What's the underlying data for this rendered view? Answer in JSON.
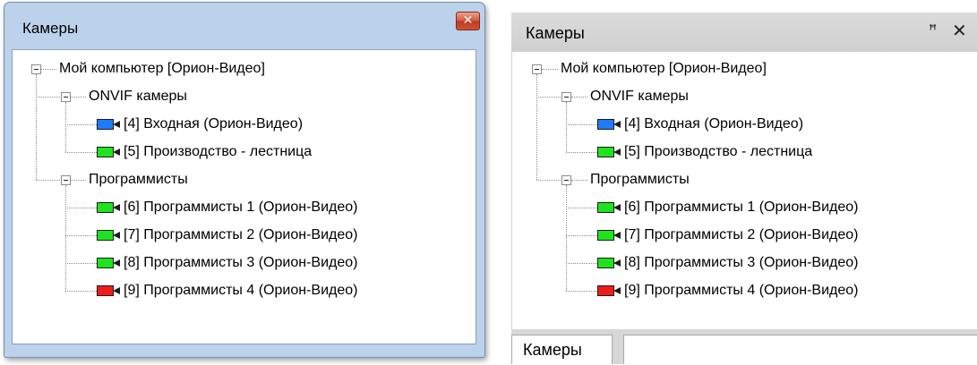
{
  "floating_window": {
    "title": "Камеры",
    "close_glyph": "✕"
  },
  "docked_panel": {
    "title": "Камеры",
    "pin_glyph": "ꟸ",
    "close_glyph": "✕",
    "bottom_tab_label": "Камеры"
  },
  "tree": {
    "root": {
      "label": "Мой компьютер [Орион-Видео]",
      "expanded": true
    },
    "groups": [
      {
        "label": "ONVIF камеры",
        "expanded": true,
        "cameras": [
          {
            "label": "[4] Входная (Орион-Видео)",
            "status_color": "#1f7bff"
          },
          {
            "label": "[5] Производство - лестница",
            "status_color": "#1fe31f"
          }
        ]
      },
      {
        "label": "Программисты",
        "expanded": true,
        "cameras": [
          {
            "label": "[6] Программисты 1 (Орион-Видео)",
            "status_color": "#1fe31f"
          },
          {
            "label": "[7] Программисты 2 (Орион-Видео)",
            "status_color": "#1fe31f"
          },
          {
            "label": "[8] Программисты 3 (Орион-Видео)",
            "status_color": "#1fe31f"
          },
          {
            "label": "[9] Программисты 4 (Орион-Видео)",
            "status_color": "#f01c1c"
          }
        ]
      }
    ]
  },
  "icons": {
    "camera": "camera-icon",
    "expander": "minus-box-icon"
  }
}
